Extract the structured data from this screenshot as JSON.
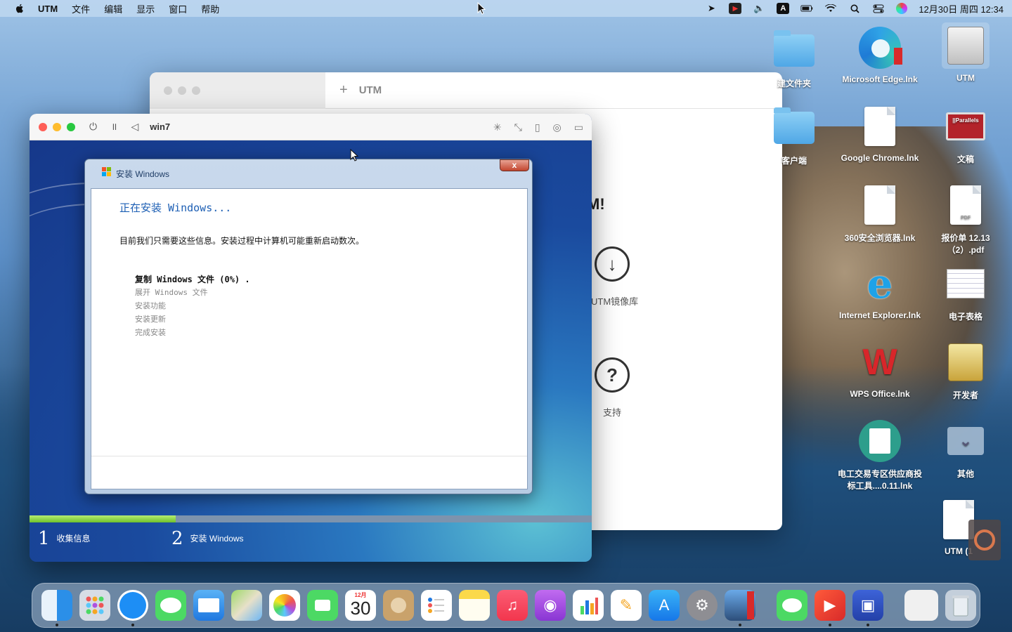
{
  "menubar": {
    "app": "UTM",
    "items": [
      "文件",
      "编辑",
      "显示",
      "窗口",
      "帮助"
    ],
    "clock": "12月30日 周四 12:34"
  },
  "utm_main": {
    "title": "UTM",
    "welcome_fragment": "M!",
    "tiles": [
      {
        "icon": "download-icon",
        "label": "UTM镜像库"
      },
      {
        "icon": "help-icon",
        "label": "支持"
      }
    ]
  },
  "vm_window": {
    "name": "win7",
    "setup": {
      "title": "安装 Windows",
      "close": "x",
      "heading": "正在安装 Windows...",
      "info": "目前我们只需要这些信息。安装过程中计算机可能重新启动数次。",
      "steps": [
        {
          "label": "复制 Windows 文件 (0%) .",
          "active": true
        },
        {
          "label": "展开 Windows 文件",
          "active": false
        },
        {
          "label": "安装功能",
          "active": false
        },
        {
          "label": "安装更新",
          "active": false
        },
        {
          "label": "完成安装",
          "active": false
        }
      ]
    },
    "progress": 0.26,
    "phases": [
      {
        "num": "1",
        "label": "收集信息"
      },
      {
        "num": "2",
        "label": "安装 Windows"
      }
    ]
  },
  "desktop_icons": [
    {
      "label": "建文件夹",
      "kind": "folder"
    },
    {
      "label": "Microsoft Edge.lnk",
      "kind": "edge"
    },
    {
      "label": "UTM",
      "kind": "disk"
    },
    {
      "label": "客户端",
      "kind": "folder"
    },
    {
      "label": "Google Chrome.lnk",
      "kind": "doc"
    },
    {
      "label": "文稿",
      "kind": "parallels"
    },
    {
      "label": "360安全浏览器.lnk",
      "kind": "doc"
    },
    {
      "label": "报价单 12.13（2）.pdf",
      "kind": "pdf",
      "badge": "PDF"
    },
    {
      "label": "Internet Explorer.lnk",
      "kind": "ie"
    },
    {
      "label": "电子表格",
      "kind": "sheet"
    },
    {
      "label": "WPS Office.lnk",
      "kind": "wps"
    },
    {
      "label": "开发者",
      "kind": "dev"
    },
    {
      "label": "电工交易专区供应商投标工具....0.11.lnk",
      "kind": "tool"
    },
    {
      "label": "其他",
      "kind": "other"
    },
    {
      "label": "UTM (1",
      "kind": "doc"
    }
  ],
  "dock": {
    "calendar_month": "12月",
    "calendar_day": "30",
    "apps": [
      "finder",
      "launchpad",
      "safari",
      "messages",
      "mail",
      "maps",
      "photos",
      "facetime",
      "calendar",
      "contacts",
      "reminders",
      "notes",
      "music",
      "podcasts",
      "numbers",
      "pages",
      "app-store",
      "system-preferences",
      "parallels",
      "wechat",
      "wps",
      "screenshot",
      "preview",
      "trash"
    ]
  },
  "colors": {
    "setup_heading": "#1d5fb4",
    "progress_fill": "#6fc22b",
    "close_red": "#c2452e"
  }
}
